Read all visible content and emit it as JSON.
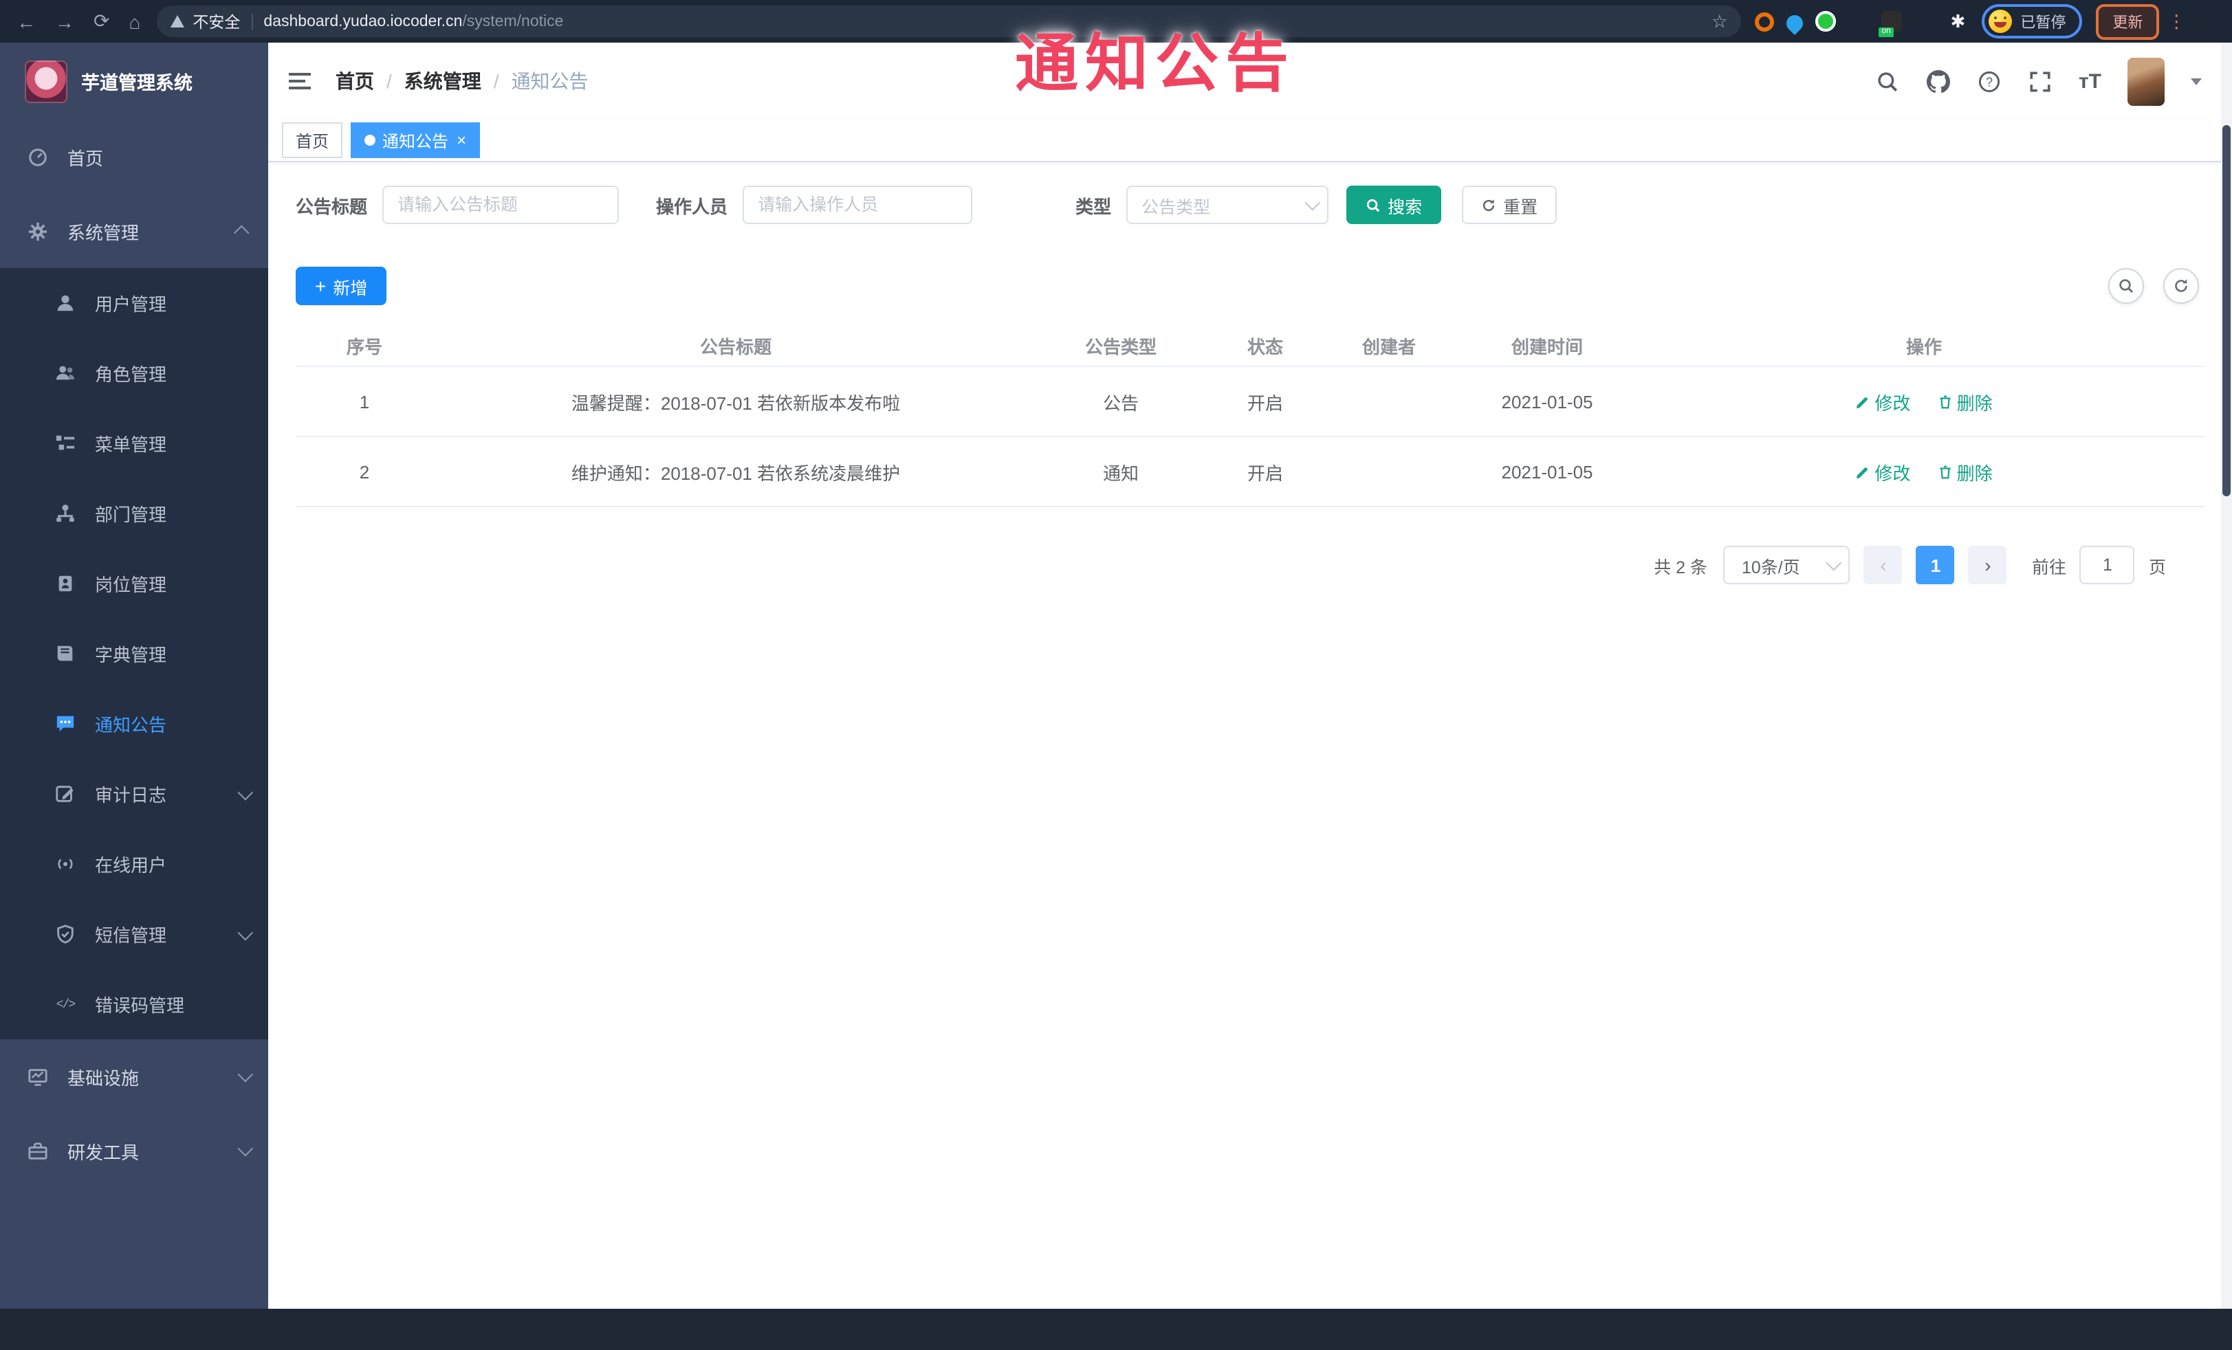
{
  "browser": {
    "security_label": "不安全",
    "url_host": "dashboard.yudao.iocoder.cn",
    "url_path": "/system/notice",
    "profile_status": "已暂停",
    "update_label": "更新",
    "extension_badge": "on"
  },
  "overlay": {
    "text": "通知公告",
    "color": "#ef4460"
  },
  "sidebar": {
    "title": "芋道管理系统",
    "home": {
      "label": "首页"
    },
    "system": {
      "label": "系统管理"
    },
    "system_children": [
      {
        "label": "用户管理"
      },
      {
        "label": "角色管理"
      },
      {
        "label": "菜单管理"
      },
      {
        "label": "部门管理"
      },
      {
        "label": "岗位管理"
      },
      {
        "label": "字典管理"
      },
      {
        "label": "通知公告",
        "active": true
      },
      {
        "label": "审计日志",
        "has_children": true
      },
      {
        "label": "在线用户"
      },
      {
        "label": "短信管理",
        "has_children": true
      },
      {
        "label": "错误码管理"
      }
    ],
    "infra": {
      "label": "基础设施"
    },
    "devtool": {
      "label": "研发工具"
    }
  },
  "header": {
    "breadcrumb": [
      {
        "label": "首页"
      },
      {
        "label": "系统管理"
      },
      {
        "label": "通知公告"
      }
    ],
    "separator": "/"
  },
  "tags": [
    {
      "label": "首页",
      "active": false
    },
    {
      "label": "通知公告",
      "active": true,
      "close": "×"
    }
  ],
  "filters": {
    "title_label": "公告标题",
    "title_placeholder": "请输入公告标题",
    "operator_label": "操作人员",
    "operator_placeholder": "请输入操作人员",
    "type_label": "类型",
    "type_placeholder": "公告类型",
    "search_label": "搜索",
    "reset_label": "重置"
  },
  "toolbar": {
    "add_label": "新增"
  },
  "table": {
    "headers": [
      "序号",
      "公告标题",
      "公告类型",
      "状态",
      "创建者",
      "创建时间",
      "操作"
    ],
    "rows": [
      {
        "index": "1",
        "title": "温馨提醒：2018-07-01 若依新版本发布啦",
        "type": "公告",
        "status": "开启",
        "creator": "",
        "created": "2021-01-05"
      },
      {
        "index": "2",
        "title": "维护通知：2018-07-01 若依系统凌晨维护",
        "type": "通知",
        "status": "开启",
        "creator": "",
        "created": "2021-01-05"
      }
    ],
    "actions": {
      "edit": "修改",
      "delete": "删除"
    }
  },
  "pagination": {
    "total": "共 2 条",
    "page_size": "10条/页",
    "prev": "‹",
    "current": "1",
    "next": "›",
    "goto_label": "前往",
    "goto_value": "1",
    "goto_unit": "页"
  },
  "colors": {
    "accent_blue": "#409eff",
    "add_button_blue": "#1989fa",
    "theme_teal": "#13a588",
    "overlay_red": "#ef4460",
    "sidebar_bg": "#3a4662",
    "submenu_bg": "#242f44",
    "chrome_bar": "#1d2634"
  }
}
